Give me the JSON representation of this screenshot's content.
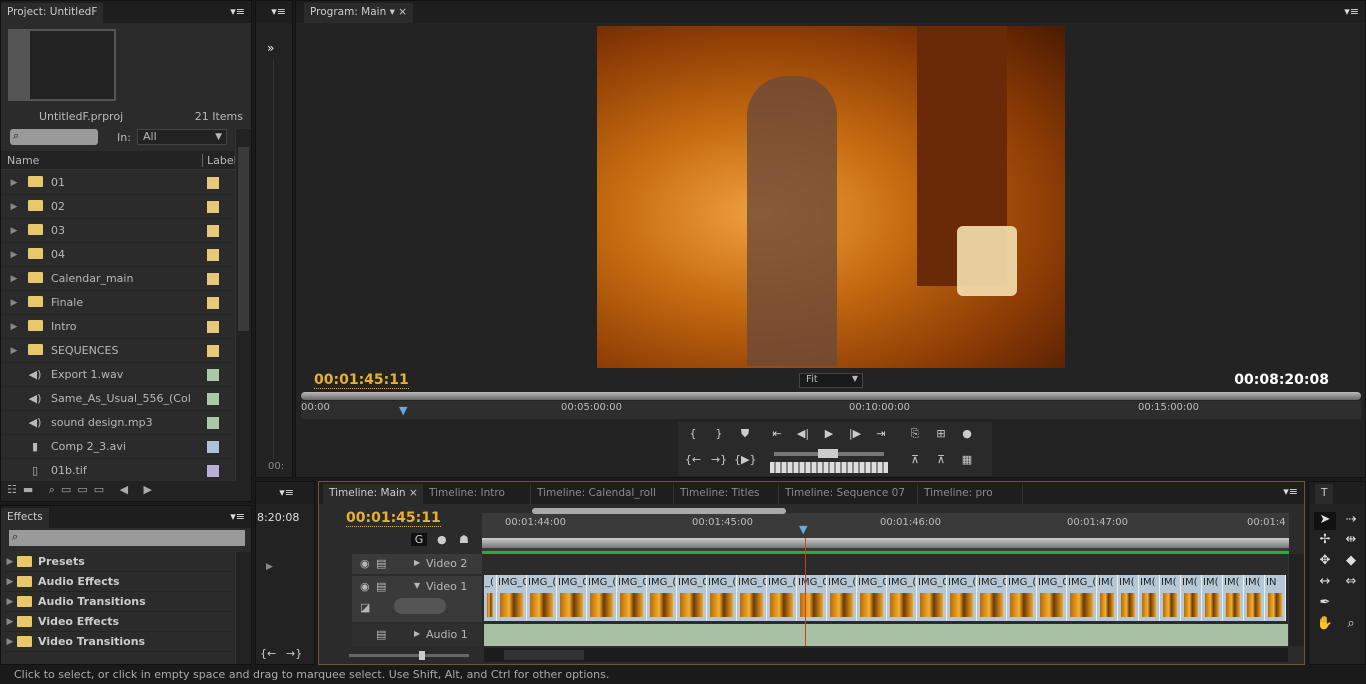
{
  "project": {
    "tab": "Project: UntitledF",
    "file": "UntitledF.prproj",
    "count": "21 Items",
    "in_label": "In:",
    "in_value": "All",
    "search_placeholder": "",
    "col_name": "Name",
    "col_label": "Label",
    "items": [
      {
        "name": "01",
        "type": "folder",
        "color": "#e8c87a"
      },
      {
        "name": "02",
        "type": "folder",
        "color": "#e8c87a"
      },
      {
        "name": "03",
        "type": "folder",
        "color": "#e8c87a"
      },
      {
        "name": "04",
        "type": "folder",
        "color": "#e8c87a"
      },
      {
        "name": "Calendar_main",
        "type": "folder",
        "color": "#e8c87a"
      },
      {
        "name": "Finale",
        "type": "folder",
        "color": "#e8c87a"
      },
      {
        "name": "Intro",
        "type": "folder",
        "color": "#e8c87a"
      },
      {
        "name": "SEQUENCES",
        "type": "folder",
        "color": "#e8c87a"
      },
      {
        "name": "Export 1.wav",
        "type": "audio",
        "color": "#a8c8a8"
      },
      {
        "name": "Same_As_Usual_556_(Col",
        "type": "audio",
        "color": "#a8c8a8"
      },
      {
        "name": "sound design.mp3",
        "type": "audio",
        "color": "#a8c8a8"
      },
      {
        "name": "Comp 2_3.avi",
        "type": "video",
        "color": "#b0c0d8"
      },
      {
        "name": "01b.tif",
        "type": "image",
        "color": "#b8b0d8"
      }
    ]
  },
  "effects": {
    "tab": "Effects",
    "items": [
      "Presets",
      "Audio Effects",
      "Audio Transitions",
      "Video Effects",
      "Video Transitions"
    ]
  },
  "program": {
    "tab": "Program: Main",
    "current_tc": "00:01:45:11",
    "duration_tc": "00:08:20:08",
    "zoom": "Fit",
    "ruler": [
      "00:00",
      "00:05:00:00",
      "00:10:00:00",
      "00:15:00:00"
    ]
  },
  "mini": {
    "tc": "8:20:08",
    "bottom_tc": "00:"
  },
  "timeline": {
    "tabs": [
      "Timeline: Main",
      "Timeline: Intro",
      "Timeline: Calendal_roll",
      "Timeline: Titles",
      "Timeline: Sequence 07",
      "Timeline: pro"
    ],
    "current_tc": "00:01:45:11",
    "ruler": [
      "00:01:44:00",
      "00:01:45:00",
      "00:01:46:00",
      "00:01:47:00",
      "00:01:4"
    ],
    "tracks": {
      "video2": "Video 2",
      "video1": "Video 1",
      "audio1": "Audio 1"
    },
    "clips": [
      "_(",
      "IMG_0",
      "IMG_(",
      "IMG_0",
      "IMG_(",
      "IMG_0",
      "IMG_(",
      "IMG_0",
      "IMG_(",
      "IMG_0",
      "IMG_(",
      "IMG_0",
      "IMG_(",
      "IMG_0",
      "IMG_(",
      "IMG_0",
      "IMG_(",
      "IMG_0",
      "IMG_(",
      "IMG_0",
      "IMG_(",
      "IM(",
      "IM(",
      "IM(",
      "IM(",
      "IM(",
      "IM(",
      "IM(",
      "IM(",
      "IN"
    ]
  },
  "tools": {
    "tab": "T"
  },
  "status": "Click to select, or click in empty space and drag to marquee select. Use Shift, Alt, and Ctrl for other options.",
  "colors": {
    "timecode": "#e8b030",
    "audio_track": "#a8c0a4",
    "playhead": "#d04020",
    "render_bar": "#20b040"
  }
}
